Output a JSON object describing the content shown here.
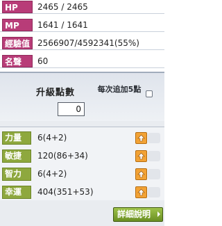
{
  "info": {
    "rows": [
      {
        "label": "HP",
        "value": "2465 / 2465"
      },
      {
        "label": "MP",
        "value": "1641 / 1641"
      },
      {
        "label": "經驗值",
        "value": "2566907/4592341(55%)"
      },
      {
        "label": "名聲",
        "value": "60"
      }
    ]
  },
  "ap": {
    "title": "升級點數",
    "value": "0",
    "auto_label": "每次追加5點",
    "auto_checked": false
  },
  "stats": {
    "rows": [
      {
        "label": "力量",
        "value": "6(4+2)"
      },
      {
        "label": "敏捷",
        "value": "120(86+34)"
      },
      {
        "label": "智力",
        "value": "6(4+2)"
      },
      {
        "label": "幸運",
        "value": "404(351+53)"
      }
    ]
  },
  "detail_button_label": "詳細說明",
  "colors": {
    "info_label_bg": "#b83c78",
    "stat_label_bg": "#8ea83e",
    "up_button": "#f2a235",
    "detail_button": "#7fa331"
  }
}
